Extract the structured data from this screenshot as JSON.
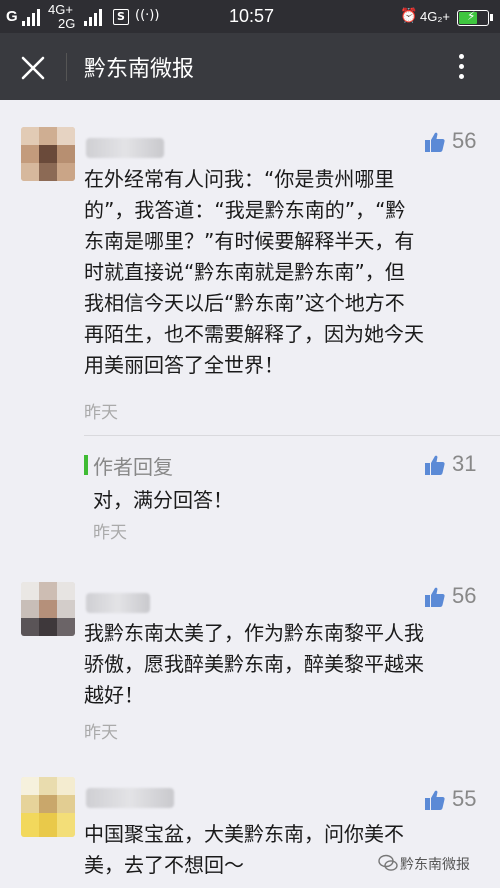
{
  "status_bar": {
    "carrier": "G",
    "network_1": "4G+",
    "network_2": "2G",
    "time": "10:57",
    "network_right": "4G₂+"
  },
  "navbar": {
    "title": "黔东南微报"
  },
  "comments": [
    {
      "likes": "56",
      "text": "在外经常有人问我：“你是贵州哪里的”，我答道：“我是黔东南的”，“黔东南是哪里？”有时候要解释半天，有时就直接说“黔东南就是黔东南”，但我相信今天以后“黔东南”这个地方不再陌生，也不需要解释了，因为她今天用美丽回答了全世界！",
      "lines": [
        "在外经常有人问我：“你是贵州哪里",
        "的”，我答道：“我是黔东南的”，“黔",
        "东南是哪里？”有时候要解释半天，有",
        "时就直接说“黔东南就是黔东南”，但",
        "我相信今天以后“黔东南”这个地方不",
        "再陌生，也不需要解释了，因为她今天",
        "用美丽回答了全世界！"
      ],
      "time": "昨天",
      "reply": {
        "label": "作者回复",
        "text": "对，满分回答！",
        "time": "昨天",
        "likes": "31"
      }
    },
    {
      "likes": "56",
      "lines": [
        "我黔东南太美了，作为黔东南黎平人我",
        "骄傲，愿我醉美黔东南，醉美黎平越来",
        "越好！"
      ],
      "time": "昨天"
    },
    {
      "likes": "55",
      "lines": [
        "中国聚宝盆，大美黔东南，问你美不",
        "美，去了不想回～"
      ]
    }
  ],
  "watermark": "黔东南微报",
  "colors": {
    "status_bar_bg": "#2e2e33",
    "navbar_bg": "#393a3f",
    "page_bg": "#efeff4",
    "like_icon": "#5b8ad6",
    "reply_accent": "#3fbb33"
  }
}
